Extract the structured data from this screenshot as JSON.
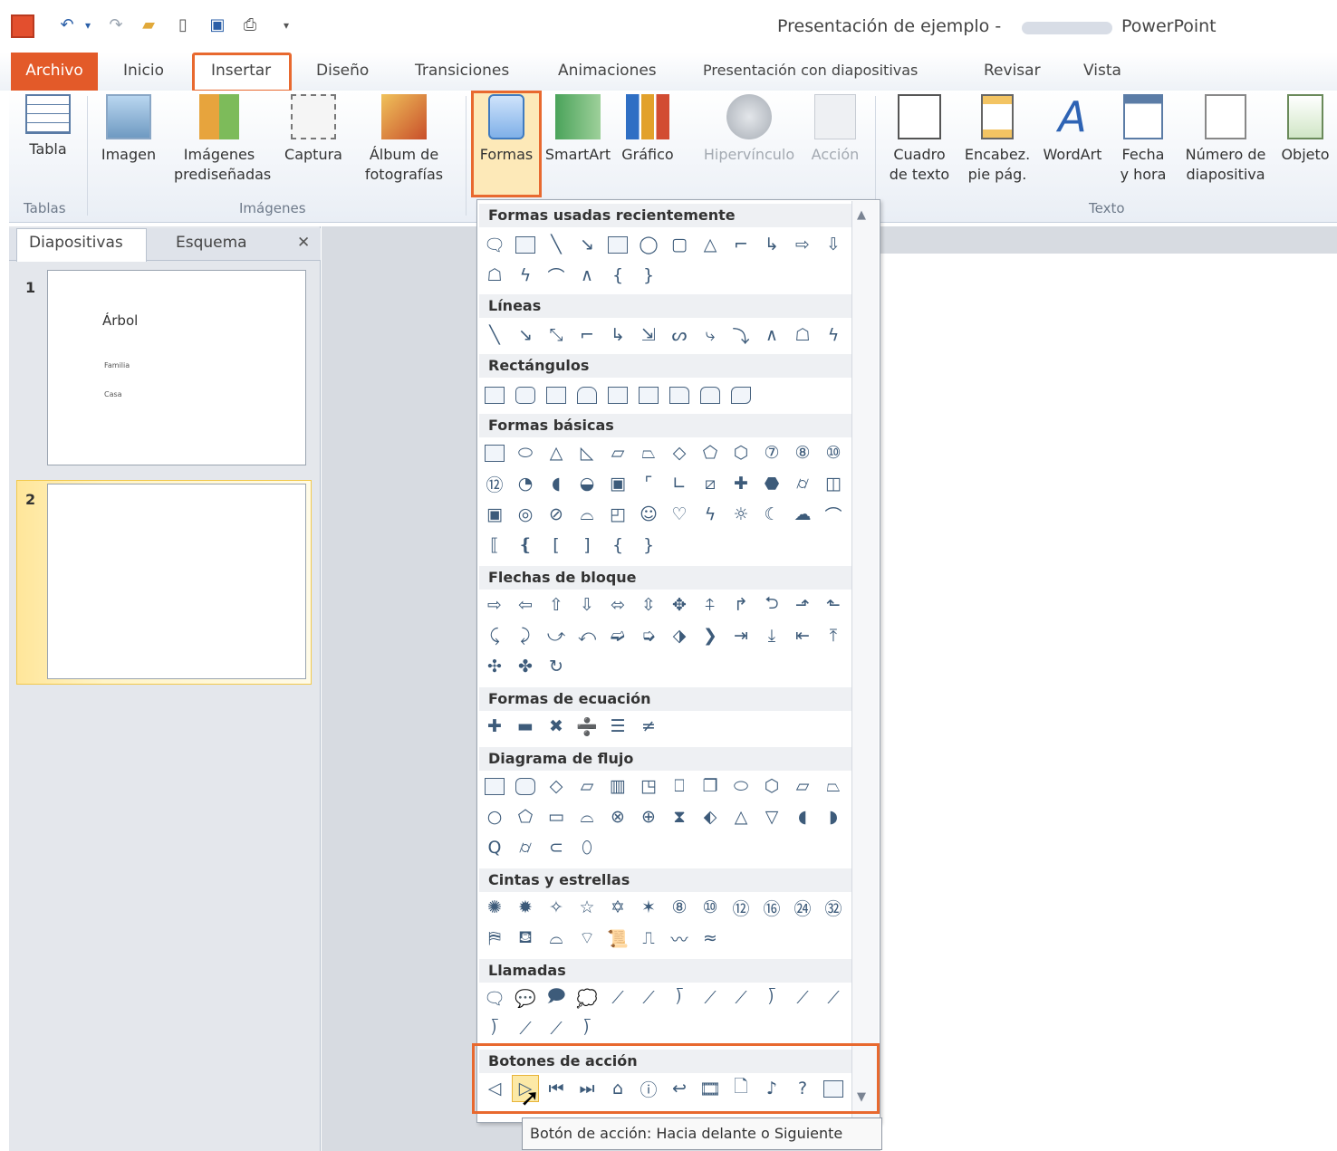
{
  "window": {
    "title": "Presentación de ejemplo -",
    "app": "PowerPoint"
  },
  "tabs": [
    "Archivo",
    "Inicio",
    "Insertar",
    "Diseño",
    "Transiciones",
    "Animaciones",
    "Presentación con diapositivas",
    "Revisar",
    "Vista"
  ],
  "ribbon": {
    "buttons": [
      "Tabla",
      "Imagen",
      "Imágenes prediseñadas",
      "Captura",
      "Álbum de fotografías",
      "Formas",
      "SmartArt",
      "Gráfico",
      "Hipervínculo",
      "Acción",
      "Cuadro de texto",
      "Encabez. pie pág.",
      "WordArt",
      "Fecha y hora",
      "Número de diapositiva",
      "Objeto"
    ],
    "groups": [
      "Tablas",
      "Imágenes",
      "Texto"
    ]
  },
  "pane": {
    "tabs": [
      "Diapositivas",
      "Esquema"
    ],
    "close": "✕",
    "slides": [
      {
        "num": "1",
        "title": "Árbol",
        "lines": [
          "Familia",
          "Casa"
        ]
      },
      {
        "num": "2"
      }
    ]
  },
  "shapes": {
    "sections": [
      "Formas usadas recientemente",
      "Líneas",
      "Rectángulos",
      "Formas básicas",
      "Flechas de bloque",
      "Formas de ecuación",
      "Diagrama de flujo",
      "Cintas y estrellas",
      "Llamadas",
      "Botones de acción"
    ]
  },
  "tooltip": "Botón de acción: Hacia delante o Siguiente",
  "colors": {
    "accent": "#e8692f",
    "file_tab": "#e35a29"
  }
}
